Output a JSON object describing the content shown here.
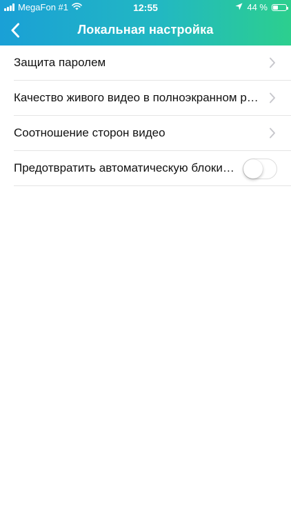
{
  "status_bar": {
    "carrier": "MegaFon #1",
    "time": "12:55",
    "battery_text": "44 %",
    "battery_level": 0.44,
    "icons": [
      "signal-icon",
      "wifi-icon",
      "location-arrow-icon",
      "battery-icon"
    ]
  },
  "nav": {
    "title": "Локальная настройка",
    "back_icon": "chevron-left-icon"
  },
  "settings": {
    "items": [
      {
        "label": "Защита паролем",
        "type": "disclosure"
      },
      {
        "label": "Качество живого видео в полноэкранном режиме",
        "type": "disclosure"
      },
      {
        "label": "Соотношение сторон видео",
        "type": "disclosure"
      },
      {
        "label": "Предотвратить автоматическую блокировку экрана",
        "type": "switch",
        "on": false
      }
    ]
  },
  "colors": {
    "header_gradient_start": "#1aa0d6",
    "header_gradient_end": "#2ccf8e",
    "divider": "#e4e4e4",
    "chevron": "#c7c7cc"
  }
}
